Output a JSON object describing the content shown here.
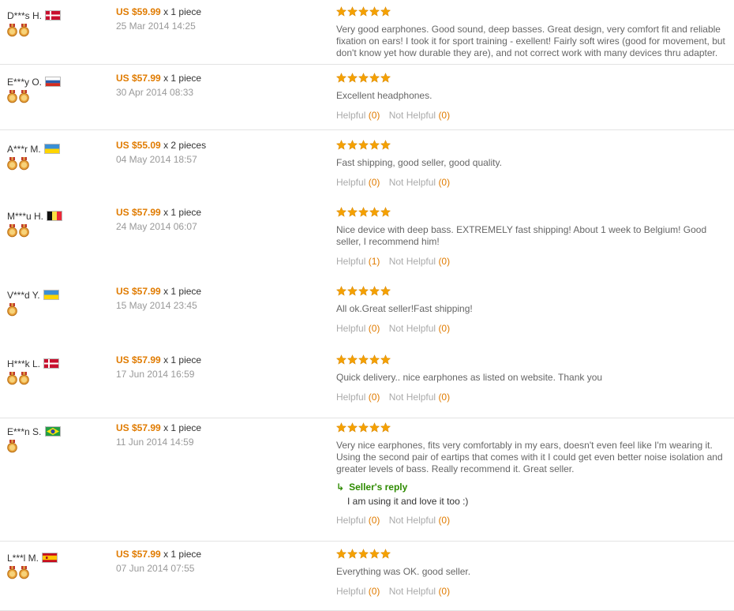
{
  "colors": {
    "price": "#e07b00",
    "star": "#f5a100",
    "reply": "#2e8b00",
    "muted": "#999999"
  },
  "labels": {
    "helpful": "Helpful",
    "not_helpful": "Not Helpful",
    "seller_reply": "Seller's reply"
  },
  "reviews": [
    {
      "buyer": "D***s H.",
      "country": "Denmark",
      "medals": 2,
      "price": "US $59.99",
      "qty": "x 1 piece",
      "date": "25 Mar 2014 14:25",
      "stars": 5,
      "text": "Very good earphones. Good sound, deep basses. Great design, very comfort fit and reliable fixation on ears! I took it for sport training - exellent! Fairly soft wires (good for movement, but don't know yet how durable they are), and not correct work with many devices thru adapter.",
      "helpful": "",
      "not_helpful": ""
    },
    {
      "buyer": "E***y O.",
      "country": "Russia",
      "medals": 2,
      "price": "US $57.99",
      "qty": "x 1 piece",
      "date": "30 Apr 2014 08:33",
      "stars": 5,
      "text": "Excellent headphones.",
      "helpful": "(0)",
      "not_helpful": "(0)"
    },
    {
      "buyer": "A***r M.",
      "country": "Ukraine",
      "medals": 2,
      "price": "US $55.09",
      "qty": "x 2 pieces",
      "date": "04 May 2014 18:57",
      "stars": 5,
      "text": "Fast shipping, good seller, good quality.",
      "helpful": "(0)",
      "not_helpful": "(0)"
    },
    {
      "buyer": "M***u H.",
      "country": "Belgium",
      "medals": 2,
      "price": "US $57.99",
      "qty": "x 1 piece",
      "date": "24 May 2014 06:07",
      "stars": 5,
      "text": "Nice device with deep bass. EXTREMELY fast shipping! About 1 week to Belgium! Good seller, I recommend him!",
      "helpful": "(1)",
      "not_helpful": "(0)"
    },
    {
      "buyer": "V***d Y.",
      "country": "Ukraine",
      "medals": 1,
      "price": "US $57.99",
      "qty": "x 1 piece",
      "date": "15 May 2014 23:45",
      "stars": 5,
      "text": "All ok.Great seller!Fast shipping!",
      "helpful": "(0)",
      "not_helpful": "(0)"
    },
    {
      "buyer": "H***k L.",
      "country": "Denmark",
      "medals": 2,
      "price": "US $57.99",
      "qty": "x 1 piece",
      "date": "17 Jun 2014 16:59",
      "stars": 5,
      "text": "Quick delivery.. nice earphones as listed on website. Thank you",
      "helpful": "(0)",
      "not_helpful": "(0)"
    },
    {
      "buyer": "E***n S.",
      "country": "Brazil",
      "medals": 1,
      "price": "US $57.99",
      "qty": "x 1 piece",
      "date": "11 Jun 2014 14:59",
      "stars": 5,
      "text": "Very nice earphones, fits very comfortably in my ears, doesn't even feel like I'm wearing it. Using the second pair of eartips that comes with it I could get even better noise isolation and greater levels of bass. Really recommend it. Great seller.",
      "reply": "I am using it and love it too :)",
      "helpful": "(0)",
      "not_helpful": "(0)"
    },
    {
      "buyer": "L***l M.",
      "country": "Spain",
      "medals": 2,
      "price": "US $57.99",
      "qty": "x 1 piece",
      "date": "07 Jun 2014 07:55",
      "stars": 5,
      "text": "Everything was OK. good seller.",
      "helpful": "(0)",
      "not_helpful": "(0)"
    }
  ]
}
